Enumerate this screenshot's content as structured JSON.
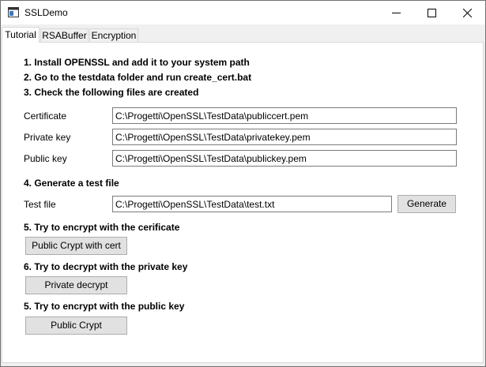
{
  "window": {
    "title": "SSLDemo"
  },
  "tabs": [
    {
      "label": "Tutorial",
      "active": true
    },
    {
      "label": "RSABuffer",
      "active": false
    },
    {
      "label": "Encryption",
      "active": false
    }
  ],
  "tutorial": {
    "step1": "1. Install OPENSSL and add it to your system path",
    "step2": "2. Go to the testdata folder and run create_cert.bat",
    "step3": "3. Check the following files are created",
    "files": {
      "certificate": {
        "label": "Certificate",
        "value": "C:\\Progetti\\OpenSSL\\TestData\\publiccert.pem"
      },
      "private_key": {
        "label": "Private key",
        "value": "C:\\Progetti\\OpenSSL\\TestData\\privatekey.pem"
      },
      "public_key": {
        "label": "Public key",
        "value": "C:\\Progetti\\OpenSSL\\TestData\\publickey.pem"
      }
    },
    "step4": "4. Generate a test file",
    "test_file": {
      "label": "Test file",
      "value": "C:\\Progetti\\OpenSSL\\TestData\\test.txt"
    },
    "generate_button": "Generate",
    "step5a": "5. Try to encrypt with the cerificate",
    "public_crypt_cert_button": "Public Crypt with cert",
    "step6": "6. Try to decrypt with the private key",
    "private_decrypt_button": "Private decrypt",
    "step5b": "5. Try to encrypt with the public key",
    "public_crypt_button": "Public Crypt"
  },
  "icons": {
    "app": "app-window-icon",
    "minimize": "minimize-icon",
    "maximize": "maximize-icon",
    "close": "close-icon"
  }
}
